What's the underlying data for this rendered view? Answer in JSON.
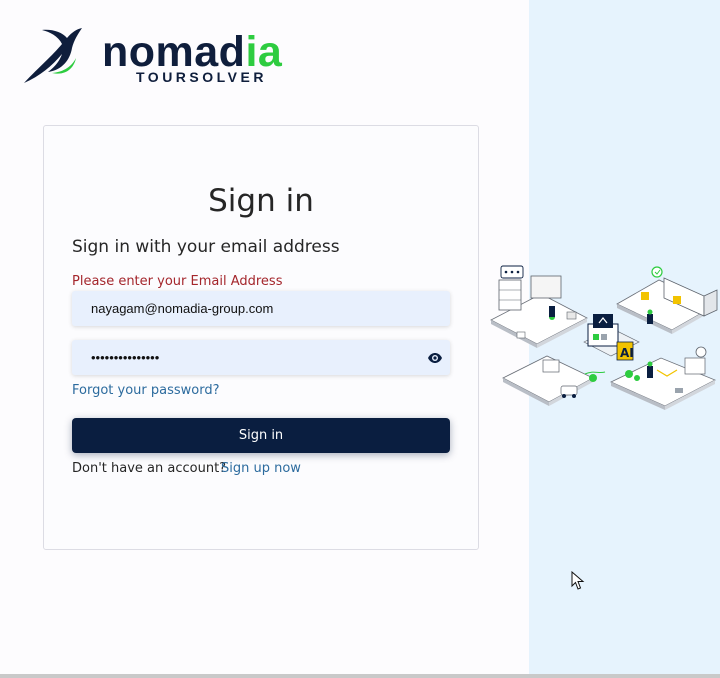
{
  "logo": {
    "brand_main": "nomad",
    "brand_accent": "ia",
    "brand_sub": "TOURSOLVER",
    "icon": "bird-icon"
  },
  "signin": {
    "title": "Sign in",
    "subtitle": "Sign in with your email address",
    "error": "Please enter your Email Address",
    "email_value": "nayagam@nomadia-group.com",
    "password_value": "•••••••••••••••",
    "forgot_link": "Forgot your password?",
    "submit_label": "Sign in",
    "no_account_text": "Don't have an account?",
    "signup_link": "Sign up now"
  },
  "colors": {
    "brand_navy": "#0a1e40",
    "brand_green": "#2ecc40",
    "error_red": "#a4262c",
    "link_blue": "#2c6b9e",
    "field_bg": "#e8f0fd",
    "right_pane_bg": "#e6f3fd"
  },
  "icons": {
    "password_toggle": "eye-icon",
    "illustration": "logistics-isometric-illustration",
    "pointer": "mouse-cursor-icon"
  }
}
